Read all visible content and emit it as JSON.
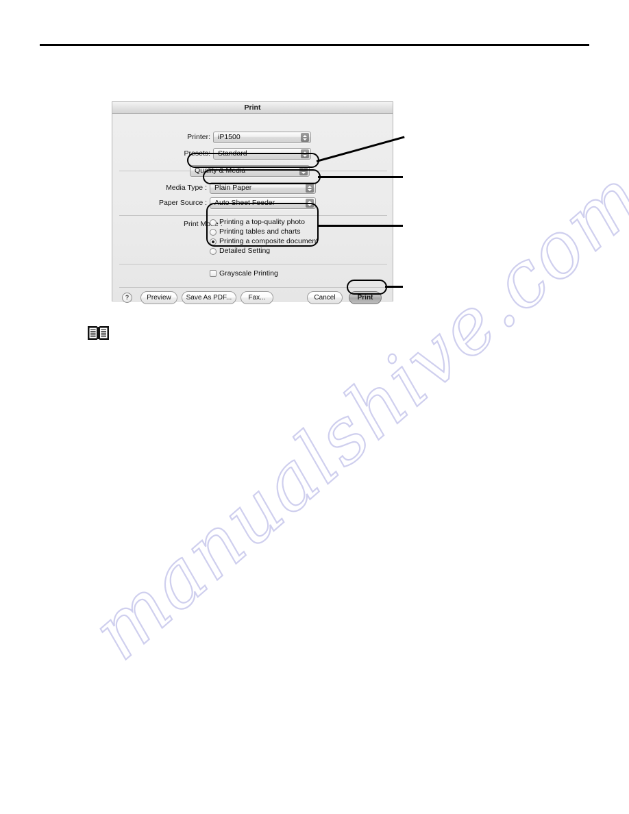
{
  "page": {
    "rule_present": true,
    "watermark_text": "manualshive.com",
    "watermark_color": "#cdcdee",
    "book_icon": "open-book-icon"
  },
  "dialog": {
    "title": "Print",
    "rows": [
      {
        "label": "Printer:",
        "value": "iP1500"
      },
      {
        "label": "Presets:",
        "value": "Standard"
      }
    ],
    "pane_popup": {
      "label": "",
      "value": "Quality & Media"
    },
    "media_type": {
      "label": "Media Type :",
      "value": "Plain Paper"
    },
    "paper_source": {
      "label": "Paper Source :",
      "value": "Auto Sheet Feeder"
    },
    "print_mode": {
      "label": "Print Mode :",
      "options": [
        {
          "label": "Printing a top-quality photo",
          "selected": false
        },
        {
          "label": "Printing tables and charts",
          "selected": false
        },
        {
          "label": "Printing a composite document",
          "selected": true
        },
        {
          "label": "Detailed Setting",
          "selected": false
        }
      ]
    },
    "grayscale": {
      "label": "Grayscale Printing",
      "checked": false
    },
    "buttons": {
      "help": "?",
      "preview": "Preview",
      "save_as_pdf": "Save As PDF...",
      "fax": "Fax...",
      "cancel": "Cancel",
      "print": "Print"
    }
  },
  "callouts": [
    {
      "target": "pane-popup",
      "kind": "slanted-leader"
    },
    {
      "target": "media-type-popup",
      "kind": "horizontal-leader"
    },
    {
      "target": "print-mode-group",
      "kind": "horizontal-leader"
    },
    {
      "target": "print-button",
      "kind": "horizontal-leader"
    }
  ]
}
